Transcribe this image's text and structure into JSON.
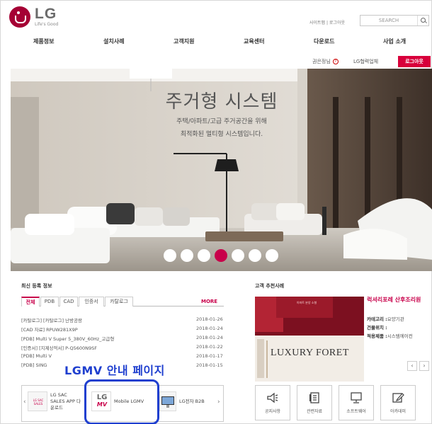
{
  "header": {
    "logo_word": "LG",
    "logo_tagline": "Life's Good",
    "util_links": "사이트맵 | 로그아웃",
    "search_placeholder": "SEARCH"
  },
  "gnb": [
    "제품정보",
    "설치사례",
    "고객지원",
    "교육센터",
    "다운로드",
    "사업 소개"
  ],
  "member": {
    "grade_label": "권은정님",
    "help_glyph": "?",
    "partner_label": "LG협력업체",
    "logout_label": "로그아웃"
  },
  "hero": {
    "title": "주거형 시스템",
    "subtitle_line1": "주택/아파트/고급 주거공간을 위해",
    "subtitle_line2": "최적화된 멀티형 시스템입니다.",
    "slide_count": 7,
    "active_slide": 4
  },
  "notice": {
    "title": "최신 등록 정보",
    "tabs": [
      "전체",
      "PDB",
      "CAD",
      "인증서",
      "카탈로그"
    ],
    "active_tab": 0,
    "more_label": "MORE",
    "rows": [
      {
        "text": "[카탈로그] [카탈로그] 난방공랑",
        "date": "2018-01-26"
      },
      {
        "text": "[CAD 자료] RPUW281X9P",
        "date": "2018-01-24"
      },
      {
        "text": "[PDB] Multi V Super 5_380V_60Hz_고급형",
        "date": "2018-01-24"
      },
      {
        "text": "[인증서] [지제상적서] P-Q5600N9SF",
        "date": "2018-01-22"
      },
      {
        "text": "[PDB] Multi V",
        "date": "2018-01-17"
      },
      {
        "text": "[PDB] SING",
        "date": "2018-01-15"
      }
    ]
  },
  "promo_label": "LGMV 안내 페이지",
  "banners": {
    "prev_glyph": "‹",
    "next_glyph": "›",
    "items": [
      {
        "thumb": "LG SAC SALES",
        "label": "LG SAC SALES APP 다운로드"
      },
      {
        "thumb_lg": "LG",
        "thumb_mv": "MV",
        "label": "Mobile LGMV"
      },
      {
        "label": "LG전자 B2B"
      }
    ]
  },
  "case": {
    "title": "고객 추천사례",
    "img_brand": "LUXURY FORET",
    "img_sign": "아파트 분양 소형",
    "name": "럭셔리포레 산후조리원",
    "rows": [
      {
        "label": "카테고리 :",
        "value": "요양기관"
      },
      {
        "label": "건물위치 :",
        "value": ""
      },
      {
        "label": "적용제품 :",
        "value": "시스템에어컨"
      }
    ],
    "prev_glyph": "‹",
    "next_glyph": "›"
  },
  "quick_links": [
    {
      "icon": "megaphone-icon",
      "label": "공지사항"
    },
    {
      "icon": "document-icon",
      "label": "관련자료"
    },
    {
      "icon": "monitor-icon",
      "label": "소프트웨어"
    },
    {
      "icon": "edit-icon",
      "label": "아카데미"
    }
  ],
  "colors": {
    "brand": "#a50034",
    "accent": "#c8004a",
    "highlight": "#1f3fcf"
  }
}
